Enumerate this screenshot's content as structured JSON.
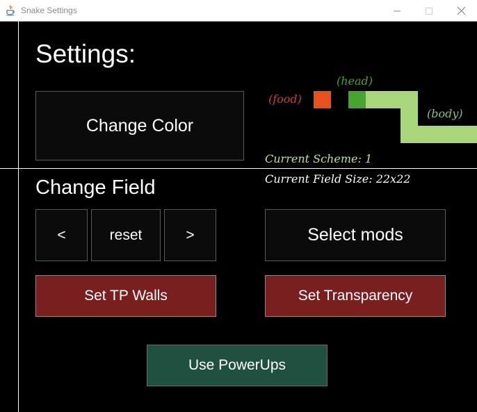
{
  "window": {
    "title": "Snake Settings"
  },
  "colors": {
    "food": "#e8501c",
    "head": "#45a52f",
    "body": "#a9d67a",
    "food_label": "#c8412d",
    "head_label": "#45a52f",
    "body_label": "#8fc16a",
    "scheme_text": "#b9e39a",
    "field_text": "#ffffff",
    "button_red": "#7a1f1f",
    "button_green": "#1f5040"
  },
  "settings": {
    "heading": "Settings:"
  },
  "change_color": {
    "label": "Change Color"
  },
  "preview": {
    "food_label": "(food)",
    "head_label": "(head)",
    "body_label": "(body)",
    "current_scheme": "Current Scheme: 1",
    "current_field_size": "Current Field Size: 22x22"
  },
  "change_field": {
    "heading": "Change Field",
    "prev_label": "<",
    "reset_label": "reset",
    "next_label": ">"
  },
  "select_mods": {
    "label": "Select mods"
  },
  "tp_walls": {
    "label": "Set TP Walls"
  },
  "transparency": {
    "label": "Set Transparency"
  },
  "powerups": {
    "label": "Use PowerUps"
  }
}
